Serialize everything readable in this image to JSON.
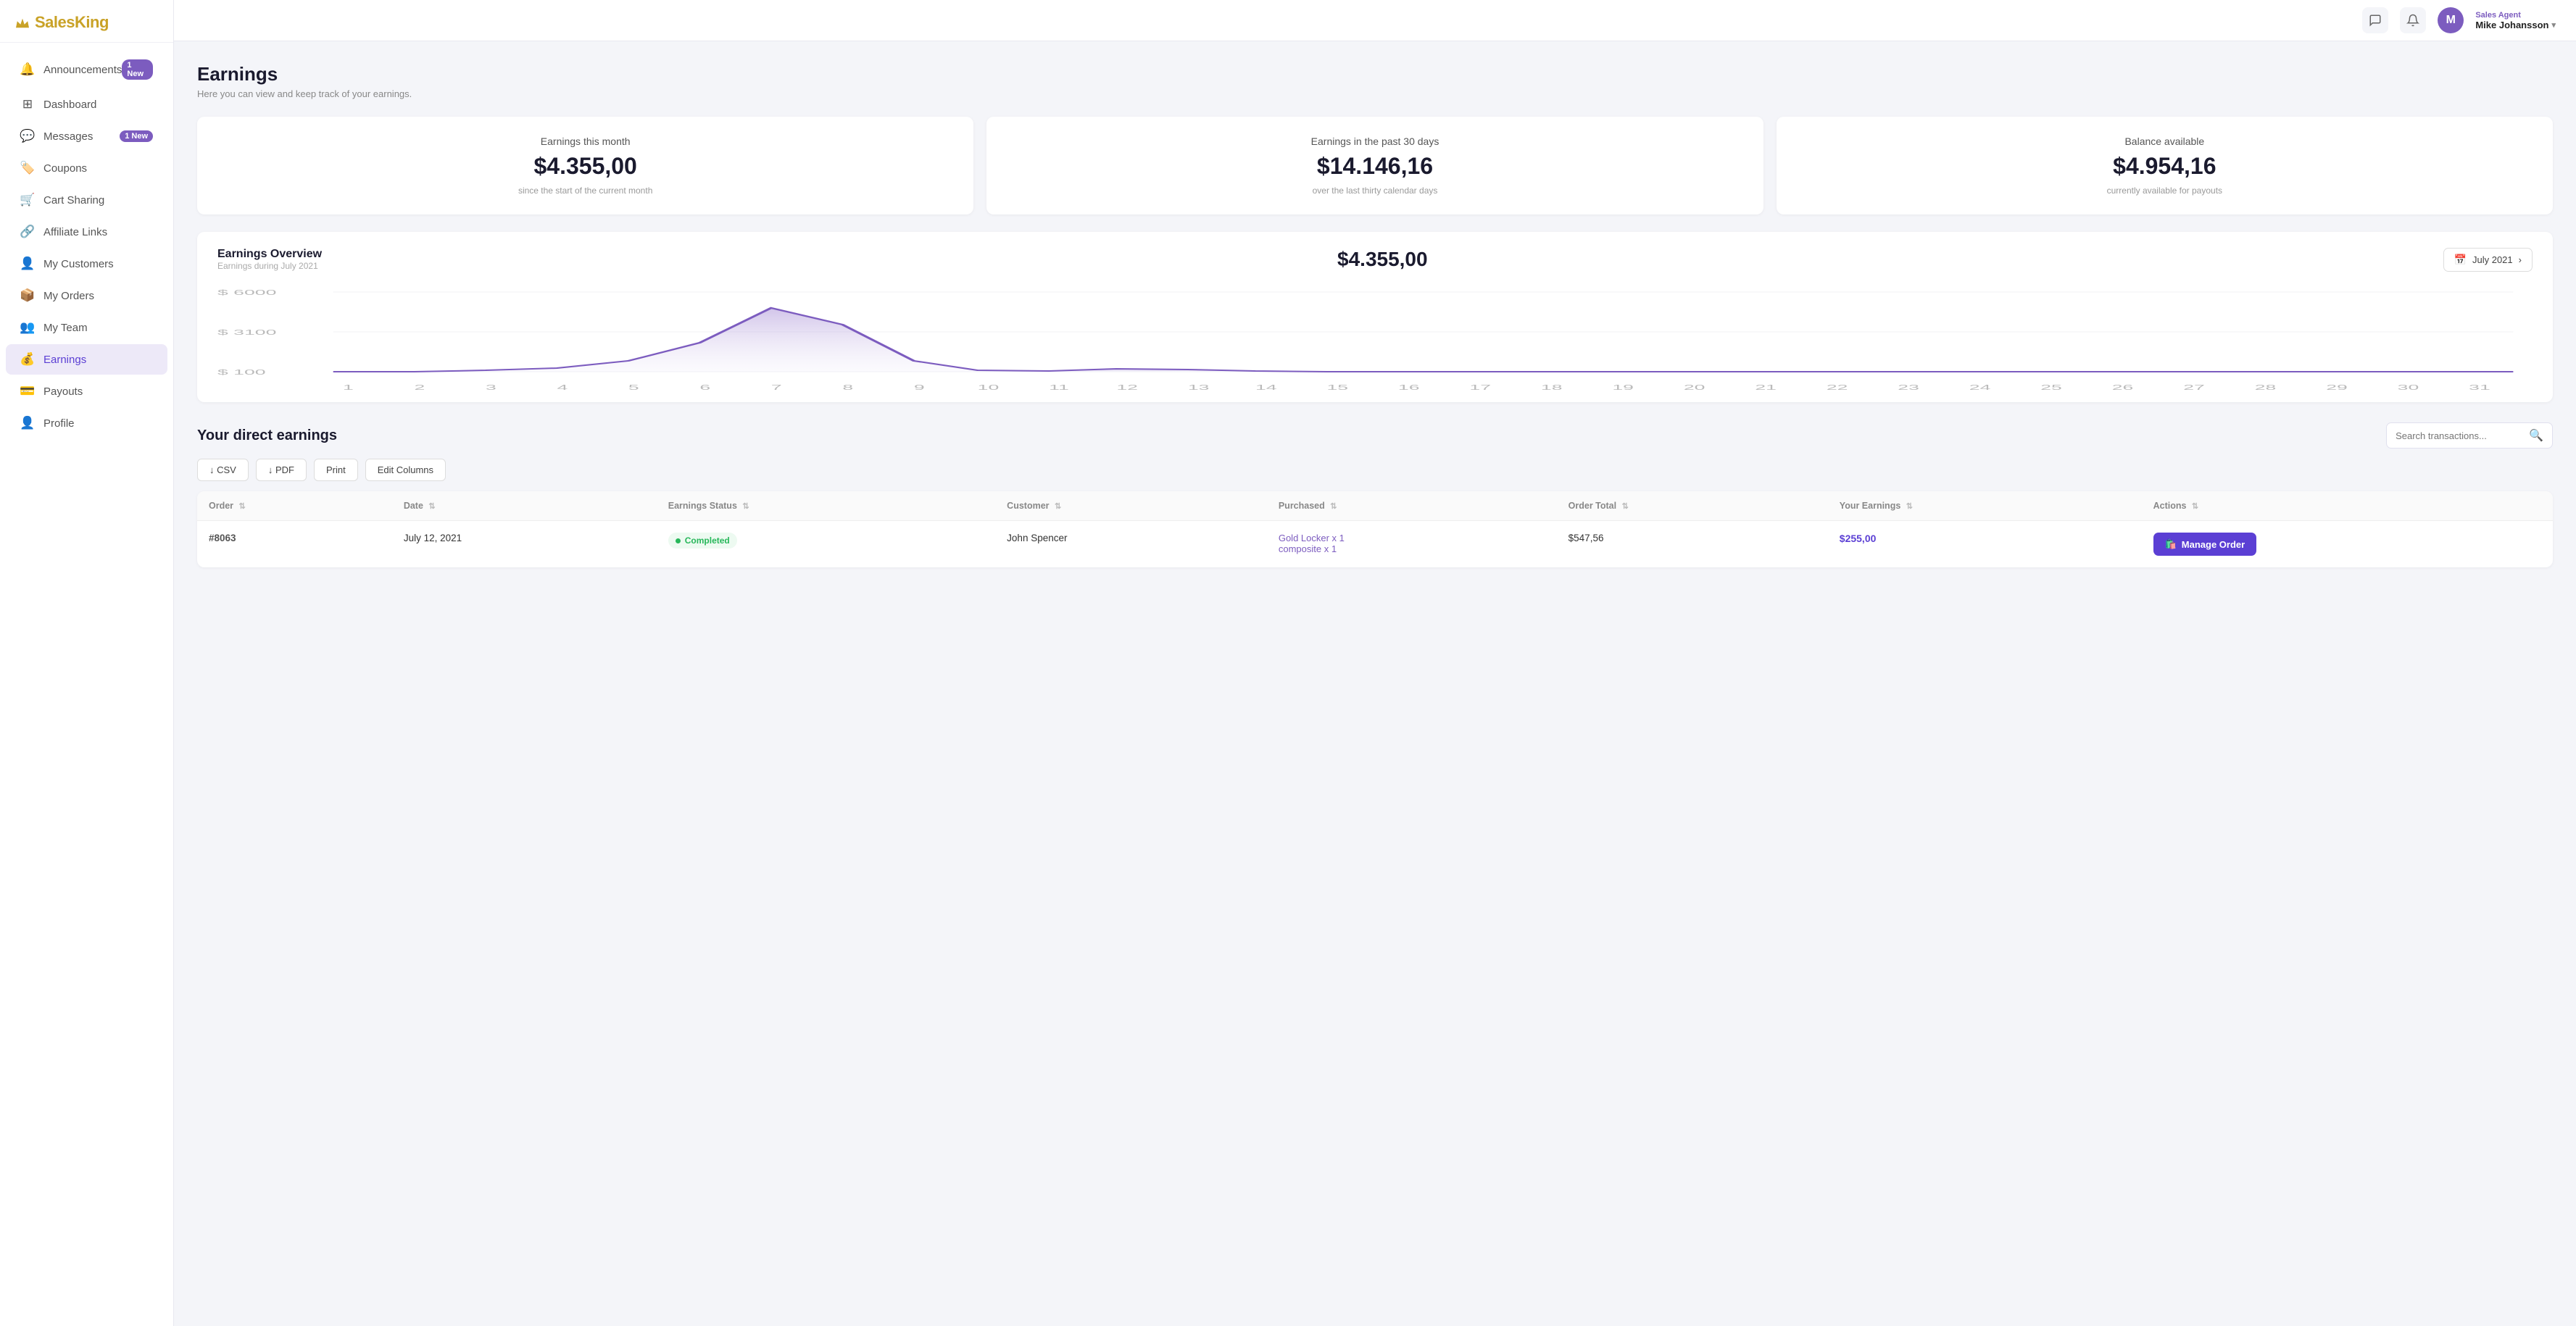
{
  "brand": {
    "name_part1": "Sales",
    "name_part2": "King"
  },
  "sidebar": {
    "items": [
      {
        "id": "announcements",
        "label": "Announcements",
        "badge": "1 New",
        "active": false,
        "icon": "bell"
      },
      {
        "id": "dashboard",
        "label": "Dashboard",
        "badge": null,
        "active": false,
        "icon": "dashboard"
      },
      {
        "id": "messages",
        "label": "Messages",
        "badge": "1 New",
        "active": false,
        "icon": "message"
      },
      {
        "id": "coupons",
        "label": "Coupons",
        "badge": null,
        "active": false,
        "icon": "coupon"
      },
      {
        "id": "cart-sharing",
        "label": "Cart Sharing",
        "badge": null,
        "active": false,
        "icon": "cart"
      },
      {
        "id": "affiliate-links",
        "label": "Affiliate Links",
        "badge": null,
        "active": false,
        "icon": "link"
      },
      {
        "id": "my-customers",
        "label": "My Customers",
        "badge": null,
        "active": false,
        "icon": "person"
      },
      {
        "id": "my-orders",
        "label": "My Orders",
        "badge": null,
        "active": false,
        "icon": "orders"
      },
      {
        "id": "my-team",
        "label": "My Team",
        "badge": null,
        "active": false,
        "icon": "team"
      },
      {
        "id": "earnings",
        "label": "Earnings",
        "badge": null,
        "active": true,
        "icon": "earnings"
      },
      {
        "id": "payouts",
        "label": "Payouts",
        "badge": null,
        "active": false,
        "icon": "payout"
      },
      {
        "id": "profile",
        "label": "Profile",
        "badge": null,
        "active": false,
        "icon": "profile"
      }
    ]
  },
  "topbar": {
    "user_role": "Sales Agent",
    "user_name": "Mike Johansson",
    "user_initials": "M"
  },
  "page": {
    "title": "Earnings",
    "subtitle": "Here you can view and keep track of your earnings."
  },
  "stat_cards": [
    {
      "label": "Earnings this month",
      "value": "$4.355,00",
      "note": "since the start of the current month"
    },
    {
      "label": "Earnings in the past 30 days",
      "value": "$14.146,16",
      "note": "over the last thirty calendar days"
    },
    {
      "label": "Balance available",
      "value": "$4.954,16",
      "note": "currently available for payouts"
    }
  ],
  "overview": {
    "title": "Earnings Overview",
    "period_label": "Earnings during July 2021",
    "total": "$4.355,00",
    "date_btn_label": "July 2021",
    "chart": {
      "y_labels": [
        "$ 6000",
        "$ 3100",
        "$ 100"
      ],
      "x_labels": [
        "1",
        "2",
        "3",
        "4",
        "5",
        "6",
        "7",
        "8",
        "9",
        "10",
        "11",
        "12",
        "13",
        "14",
        "15",
        "16",
        "17",
        "18",
        "19",
        "20",
        "21",
        "22",
        "23",
        "24",
        "25",
        "26",
        "27",
        "28",
        "29",
        "30",
        "31"
      ],
      "peak_day": 7,
      "peak_value": 4355
    }
  },
  "direct_earnings": {
    "title": "Your direct earnings",
    "search_placeholder": "Search transactions...",
    "toolbar_buttons": [
      {
        "id": "csv",
        "label": "↓ CSV"
      },
      {
        "id": "pdf",
        "label": "↓ PDF"
      },
      {
        "id": "print",
        "label": "Print"
      },
      {
        "id": "edit-columns",
        "label": "Edit Columns"
      }
    ],
    "columns": [
      "Order",
      "Date",
      "Earnings Status",
      "Customer",
      "Purchased",
      "Order Total",
      "Your Earnings",
      "Actions"
    ],
    "rows": [
      {
        "order": "#8063",
        "date": "July 12, 2021",
        "status": "Completed",
        "customer": "John Spencer",
        "purchased": "Gold Locker x 1\ncomposite x 1",
        "order_total": "$547,56",
        "your_earnings": "$255,00",
        "action": "Manage Order"
      }
    ]
  }
}
